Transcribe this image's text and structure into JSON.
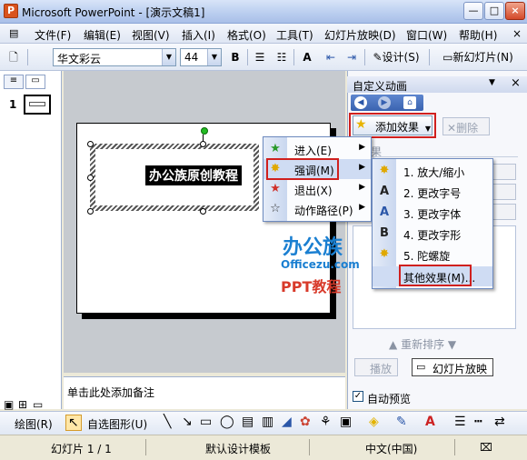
{
  "window": {
    "title": "Microsoft PowerPoint - [演示文稿1]",
    "app_icon": "P",
    "controls": {
      "minimize": "—",
      "maximize": "□",
      "close": "×"
    }
  },
  "menubar": {
    "items": [
      "文件(F)",
      "编辑(E)",
      "视图(V)",
      "插入(I)",
      "格式(O)",
      "工具(T)",
      "幻灯片放映(D)",
      "窗口(W)",
      "帮助(H)"
    ],
    "close_glyph": "×"
  },
  "toolbar": {
    "font": "华文彩云",
    "size": "44",
    "bold": "B",
    "design": "设计(S)",
    "new_slide": "新幻灯片(N)"
  },
  "thumbnails": {
    "slide_number": "1"
  },
  "slide": {
    "title_text": "办公族原创教程"
  },
  "notes": {
    "placeholder": "单击此处添加备注"
  },
  "task_pane": {
    "title": "自定义动画",
    "add_effect": "添加效果",
    "delete": "删除",
    "effect_section": "效果",
    "reorder": "重新排序",
    "play": "播放",
    "slideshow": "幻灯片放映",
    "autopreview": "自动预览",
    "autopreview_checked": true
  },
  "add_menu": {
    "items": [
      {
        "label": "进入(E)",
        "icon": "green-star-icon"
      },
      {
        "label": "强调(M)",
        "icon": "yellow-star-icon"
      },
      {
        "label": "退出(X)",
        "icon": "red-star-icon"
      },
      {
        "label": "动作路径(P)",
        "icon": "outline-star-icon"
      }
    ]
  },
  "emphasis_menu": {
    "items": [
      "1. 放大/缩小",
      "2. 更改字号",
      "3. 更改字体",
      "4. 更改字形",
      "5. 陀螺旋",
      "其他效果(M)..."
    ]
  },
  "watermark": {
    "brand": "办公族",
    "domain": "Officezu.com",
    "subtitle": "PPT教程"
  },
  "drawbar": {
    "draw": "绘图(R)",
    "autoshapes": "自选图形(U)"
  },
  "status": {
    "slide": "幻灯片 1 / 1",
    "template": "默认设计模板",
    "language": "中文(中国)"
  },
  "colors": {
    "highlight_red": "#d0201e",
    "brand_blue": "#1a7fd1",
    "brand_red": "#d83a2a",
    "accent": "#3a63b0"
  }
}
